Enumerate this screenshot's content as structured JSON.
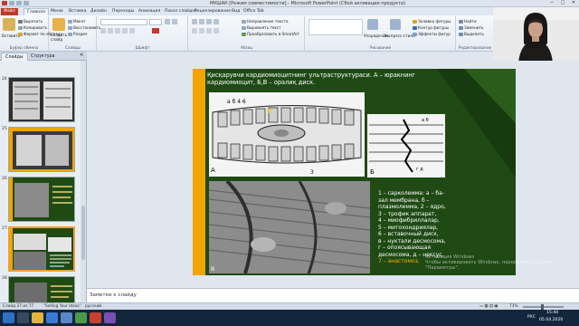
{
  "window": {
    "title": "МУШАК [Режим совместимости] - Microsoft PowerPoint (Сбой активации продукта)",
    "minimize": "─",
    "maximize": "□",
    "close": "✕"
  },
  "ribbon_tabs": [
    "Файл",
    "Главная",
    "Меню",
    "Вставка",
    "Дизайн",
    "Переходы",
    "Анимация",
    "Показ слайдов",
    "Рецензирование",
    "Вид",
    "Office Tab"
  ],
  "ribbon": {
    "clipboard": {
      "label": "Буфер обмена",
      "paste": "Вставить",
      "cut": "Вырезать",
      "copy": "Копировать",
      "format": "Формат по образцу"
    },
    "slides": {
      "label": "Слайды",
      "new_slide": "Создать слайд",
      "layout": "Макет",
      "reset": "Восстановить",
      "section": "Раздел"
    },
    "font": {
      "label": "Шрифт"
    },
    "paragraph": {
      "label": "Абзац",
      "direction": "Направление текста",
      "align": "Выровнять текст",
      "smartart": "Преобразовать в SmartArt"
    },
    "drawing": {
      "label": "Рисование",
      "arrange": "Упорядочить",
      "quick_styles": "Экспресс-стили",
      "fill": "Заливка фигуры",
      "outline": "Контур фигуры",
      "effects": "Эффекты фигур"
    },
    "editing": {
      "label": "Редактирование",
      "find": "Найти",
      "replace": "Заменить",
      "select": "Выделить"
    }
  },
  "pane": {
    "tab_slides": "Слайды",
    "tab_outline": "Структура",
    "thumb_numbers": [
      "24",
      "25",
      "26",
      "27",
      "28"
    ]
  },
  "slide": {
    "title": "Қисқарувчи кардиомиоцитнинг ультраструктураси. А – юракнинг  кардиомиоцит, Б,В – оралиқ диск.",
    "figure_labels": {
      "A": "А",
      "B": "Б",
      "V": "В"
    },
    "legend": [
      {
        "text": "1 – сарколемма:  а – ба-",
        "color": "white"
      },
      {
        "text": "зал мембрана, б –",
        "color": "white"
      },
      {
        "text": "плазмолемма,  2 – ядро,",
        "color": "white"
      },
      {
        "text": "3 – трофик аппарат,",
        "color": "white"
      },
      {
        "text": "4 – миофибриллалар,",
        "color": "white"
      },
      {
        "text": "5 – митохондриялар,",
        "color": "white"
      },
      {
        "text": "6 – вставочный диск,",
        "color": "white"
      },
      {
        "text": "в – нуктали десмосома,",
        "color": "white"
      },
      {
        "text": "г – опоясывающая",
        "color": "white"
      },
      {
        "text": "десмосома, д – нексус,",
        "color": "white"
      },
      {
        "text": "7 – анастомоз.",
        "color": "orange"
      }
    ]
  },
  "watermark": {
    "line1": "Активация Windows",
    "line2": "Чтобы активировать Windows, перейдите в раздел",
    "line3": "\"Параметры\"."
  },
  "notes": {
    "label": "Заметки к слайду"
  },
  "status": {
    "slide": "Слайд 27 из 77",
    "theme": "\"Selling Your Ideas\"",
    "lang": "русский",
    "zoom": "71%"
  },
  "taskbar": {
    "lang": "РУС",
    "time": "15:40",
    "date": "05.04.2020"
  },
  "colors": {
    "slide_bg": "#1f4a14",
    "accent": "#f0a500",
    "ribbon_file": "#c0392b"
  }
}
